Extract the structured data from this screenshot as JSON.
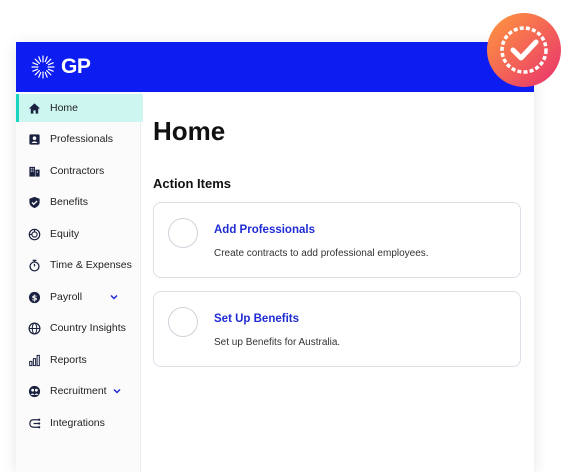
{
  "brand": {
    "name": "GP"
  },
  "sidebar": {
    "items": [
      {
        "label": "Home",
        "icon": "home-icon",
        "active": true
      },
      {
        "label": "Professionals",
        "icon": "id-badge-icon"
      },
      {
        "label": "Contractors",
        "icon": "building-icon"
      },
      {
        "label": "Benefits",
        "icon": "shield-check-icon"
      },
      {
        "label": "Equity",
        "icon": "equity-icon"
      },
      {
        "label": "Time & Expenses",
        "icon": "stopwatch-icon"
      },
      {
        "label": "Payroll",
        "icon": "dollar-circle-icon",
        "expandable": true
      },
      {
        "label": "Country Insights",
        "icon": "globe-icon"
      },
      {
        "label": "Reports",
        "icon": "bar-chart-icon"
      },
      {
        "label": "Recruitment",
        "icon": "people-icon",
        "expandable": true
      },
      {
        "label": "Integrations",
        "icon": "integrations-icon"
      }
    ]
  },
  "main": {
    "title": "Home",
    "section_title": "Action Items",
    "cards": [
      {
        "title": "Add Professionals",
        "description": "Create contracts to add professional employees."
      },
      {
        "title": "Set Up Benefits",
        "description": "Set up Benefits for Australia."
      }
    ]
  },
  "colors": {
    "topbar": "#0d1cf0",
    "active_bg": "#cdf6f1",
    "active_accent": "#18d6c0",
    "link": "#1f2bd4",
    "icon": "#1a2240",
    "badge_gradient_start": "#ff9a3c",
    "badge_gradient_end": "#e8306f"
  }
}
